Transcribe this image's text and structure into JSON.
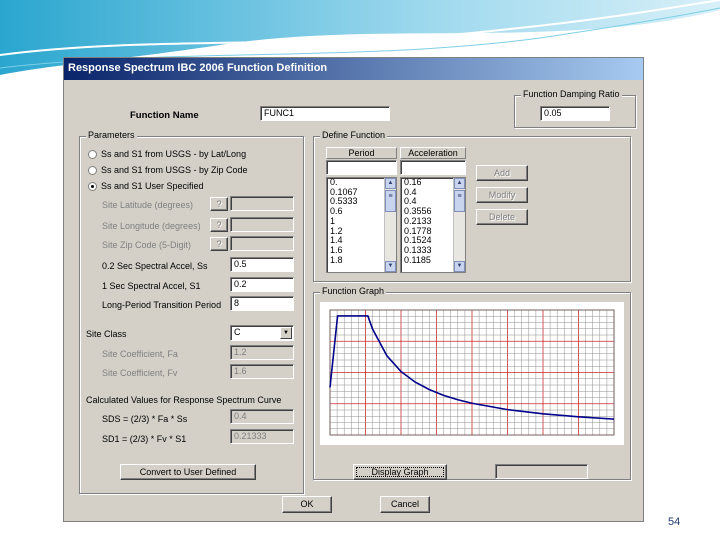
{
  "slide": {
    "page_number": "54"
  },
  "dialog": {
    "title": "Response Spectrum IBC 2006 Function Definition",
    "function_name_label": "Function Name",
    "function_name_value": "FUNC1",
    "damping": {
      "legend": "Function Damping Ratio",
      "value": "0.05"
    },
    "parameters": {
      "legend": "Parameters",
      "radios": [
        {
          "label": "Ss and S1 from USGS - by Lat/Long",
          "selected": false
        },
        {
          "label": "Ss and S1 from USGS - by Zip Code",
          "selected": false
        },
        {
          "label": "Ss and S1 User Specified",
          "selected": true
        }
      ],
      "latitude_label": "Site Latitude (degrees)",
      "longitude_label": "Site Longitude (degrees)",
      "zip_label": "Site Zip Code (5-Digit)",
      "question_label": "?",
      "ss_label": "0.2 Sec Spectral Accel, Ss",
      "ss_value": "0.5",
      "s1_label": "1 Sec Spectral Accel, S1",
      "s1_value": "0.2",
      "tl_label": "Long-Period Transition Period",
      "tl_value": "8",
      "site_class_label": "Site Class",
      "site_class_value": "C",
      "fa_label": "Site Coefficient, Fa",
      "fa_value": "1.2",
      "fv_label": "Site Coefficient, Fv",
      "fv_value": "1.6",
      "calc_heading": "Calculated Values for Response Spectrum Curve",
      "sds_label": "SDS = (2/3) * Fa * Ss",
      "sds_value": "0.4",
      "sd1_label": "SD1 = (2/3) * Fv * S1",
      "sd1_value": "0.21333",
      "convert_button": "Convert to User Defined"
    },
    "define_function": {
      "legend": "Define Function",
      "period_header": "Period",
      "accel_header": "Acceleration",
      "periods": [
        "0.",
        "0.1067",
        "0.5333",
        "0.6",
        "1",
        "1.2",
        "1.4",
        "1.6",
        "1.8"
      ],
      "accelerations": [
        "0.16",
        "0.4",
        "0.4",
        "0.3556",
        "0.2133",
        "0.1778",
        "0.1524",
        "0.1333",
        "0.1185"
      ],
      "add_button": "Add",
      "modify_button": "Modify",
      "delete_button": "Delete"
    },
    "graph": {
      "legend": "Function Graph",
      "display_button": "Display Graph",
      "display_field_value": ""
    },
    "ok_button": "OK",
    "cancel_button": "Cancel"
  },
  "chart_data": {
    "type": "line",
    "title": "",
    "xlabel": "",
    "ylabel": "",
    "grid": true,
    "series": [
      {
        "color": "#00008b",
        "x": [
          0,
          0.1067,
          0.5333,
          0.6,
          0.8,
          1.0,
          1.2,
          1.4,
          1.6,
          1.8,
          2.0,
          2.5,
          3.0,
          3.5,
          4.0
        ],
        "y": [
          0.16,
          0.4,
          0.4,
          0.3556,
          0.2667,
          0.2133,
          0.1778,
          0.1524,
          0.1333,
          0.1185,
          0.1067,
          0.0853,
          0.0711,
          0.061,
          0.0533
        ]
      }
    ],
    "xlim": [
      0,
      4
    ],
    "ylim": [
      0,
      0.42
    ]
  },
  "colors": {
    "title_bar": "#0a246a",
    "grid_major": "#cc2a2a",
    "grid_minor": "#909090",
    "curve": "#00008b"
  }
}
